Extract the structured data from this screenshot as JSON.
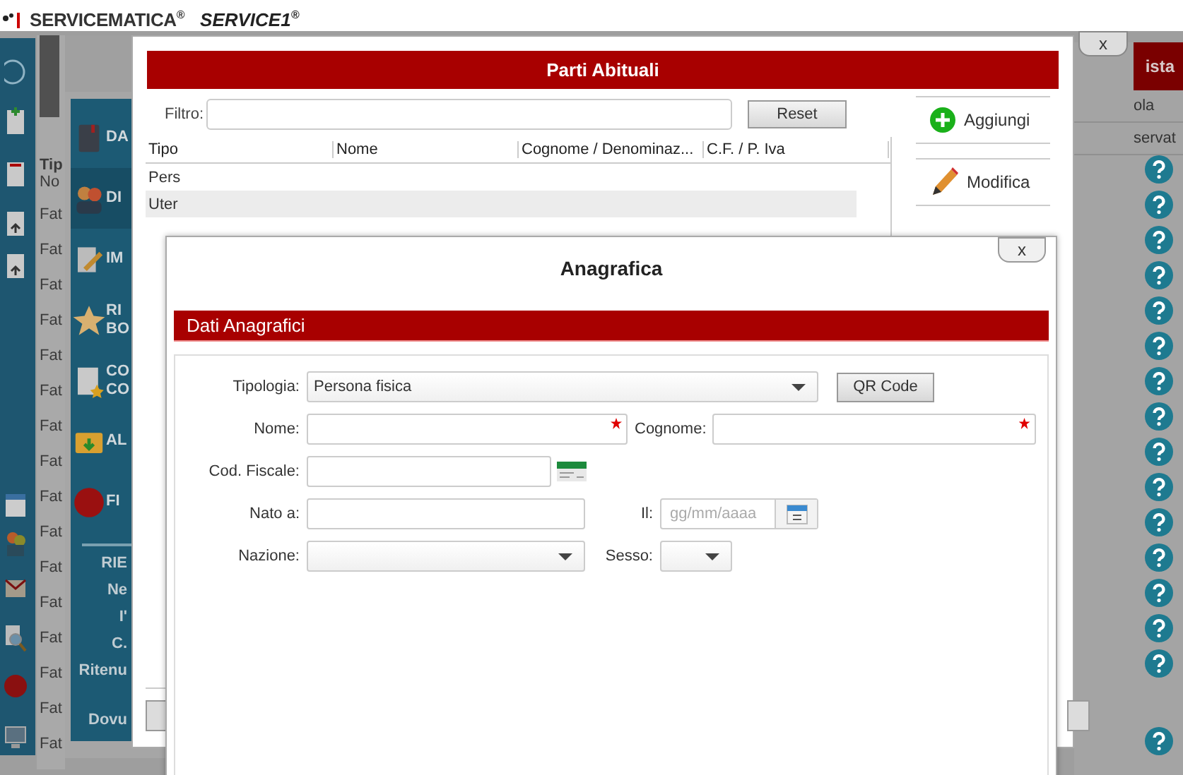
{
  "title_bar": {
    "brand": "SERVICEMATICA$^{®}$",
    "product": "SERVICE1$^{®}$"
  },
  "background_list": {
    "header": "Tip",
    "subheader": "No",
    "rows": [
      "Fat",
      "Fat",
      "Fat",
      "Fat",
      "Fat",
      "Fat",
      "Fat",
      "Fat",
      "Fat",
      "Fat",
      "Fat",
      "Fat",
      "Fat",
      "Fat",
      "Fat",
      "Fat"
    ]
  },
  "background_menu": {
    "items": [
      {
        "lines": [
          "DA"
        ]
      },
      {
        "lines": [
          "DI"
        ]
      },
      {
        "lines": [
          "IM"
        ]
      },
      {
        "lines": [
          "RI",
          "BO"
        ]
      },
      {
        "lines": [
          "CO",
          "CO"
        ]
      },
      {
        "lines": [
          "AL"
        ]
      },
      {
        "lines": [
          "FI"
        ]
      }
    ]
  },
  "background_summary": [
    "RIE",
    "Ne",
    "I'",
    "C.",
    "Ritenu",
    "Dovu"
  ],
  "background_right": {
    "header": "ista",
    "column_1": "ola",
    "column_2": "servat"
  },
  "parti_abituali": {
    "title": "Parti Abituali",
    "close": "x",
    "filter_label": "Filtro:",
    "reset": "Reset",
    "columns": [
      "Tipo",
      "Nome",
      "Cognome / Denominaz...",
      "C.F. / P. Iva"
    ],
    "rows": [
      {
        "tipo": "Pers",
        "selected": false
      },
      {
        "tipo": "Uter",
        "selected": true
      }
    ],
    "actions": [
      "Aggiungi",
      "Modifica"
    ]
  },
  "anagrafica": {
    "title": "Anagrafica",
    "close": "x",
    "section": "Dati Anagrafici",
    "tipologia": {
      "label": "Tipologia:",
      "value": "Persona fisica"
    },
    "qr_button": "QR Code",
    "nome": {
      "label": "Nome:",
      "required": true
    },
    "cognome": {
      "label": "Cognome:",
      "required": true
    },
    "cod_fiscale": {
      "label": "Cod. Fiscale:"
    },
    "nato_a": {
      "label": "Nato a:"
    },
    "il": {
      "label": "Il:",
      "placeholder": "gg/mm/aaaa"
    },
    "nazione": {
      "label": "Nazione:"
    },
    "sesso": {
      "label": "Sesso:"
    }
  }
}
